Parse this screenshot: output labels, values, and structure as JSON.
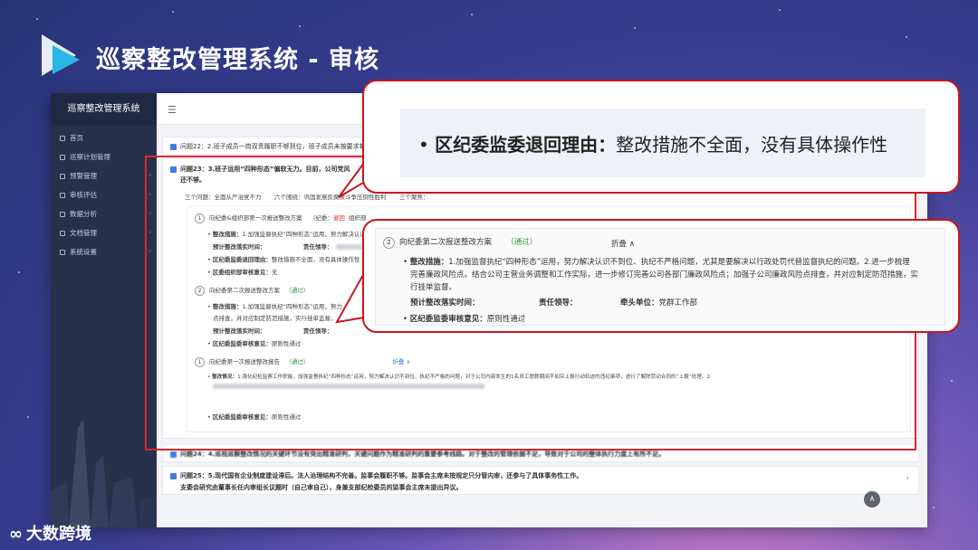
{
  "slide": {
    "title": "巡察整改管理系统 - 审核",
    "watermark": "大数跨境"
  },
  "app": {
    "sidebar_title": "巡察整改管理系统",
    "menu": [
      {
        "label": "首页"
      },
      {
        "label": "巡察计划管理"
      },
      {
        "label": "预警管理"
      },
      {
        "label": "审核评估"
      },
      {
        "label": "数据分析"
      },
      {
        "label": "文档管理"
      },
      {
        "label": "系统设置"
      }
    ]
  },
  "issues": {
    "q22": {
      "title": "问题22：2.班子成员一岗双责履职不够到位，班子成员未按要求每季"
    },
    "q23": {
      "title": "问题23：3.班子运用“四种形态”偏软无力。目前，公司党风",
      "title2": "还不够。",
      "tags": "三个问题：全面从严治党不力",
      "tags2": "六个围绕：巩固发展反腐败斗争压倒性胜利",
      "tags3": "三个聚焦：",
      "step1": {
        "num": "1",
        "title": "向纪委&组织部第一次报送整改方案",
        "record": "（纪委：",
        "status": "退回",
        "record2": "组织部",
        "measure_label": "整改措施：",
        "measure": "1.加强监督执纪“四种形态”运用，努力解决认识",
        "plan_label": "预计整改落实时间：",
        "leader_label": "责任领导：",
        "reject_label": "区纪委监委退回理由：",
        "reject": "整改措施不全面，没有具体操作性",
        "org_label": "区委组织部审核意见：",
        "org": "无"
      },
      "step2": {
        "num": "2",
        "title": "向纪委第二次报送整改方案",
        "status": "（通过）",
        "measure_label": "整改措施：",
        "measure": "1.加强监督执纪“四种形态”运用，努力",
        "measure2": "点排查，并对应制定防范措施，实行挂单监督。",
        "plan_label": "预计整改落实时间：",
        "leader_label": "责任领导：",
        "opinion_label": "区纪委监委审核意见：",
        "opinion": "原则性通过"
      },
      "step3": {
        "num": "1",
        "title": "向纪委第一次报送整改报告",
        "status": "（通过）",
        "fold": "折叠 ∧",
        "measure_label": "整改情况：",
        "measure": "1.强化纪检监察工作职能，加强监督执纪“四种形态”运用，努力解决认识不到位、执纪不严格的问题，对于公司内部发生的1名员工提薪期间不如实上报行动轨迹的违纪事项，进行了解除劳动合同的“上报”处理。2.",
        "opinion_label": "区纪委监委审核意见：",
        "opinion": "原则性通过"
      }
    },
    "q24": {
      "title": "问题24：4.巡视巡察整改情况的关键环节没有突出精准研判，关键问题作为精准研判的重要参考线路。对于整改的管理依据不足，导致对于公司的整体执行力度上有所不足。"
    },
    "q25": {
      "title": "问题25：5.现代国有企业制度建设滞后。法人治理结构不完善。监事会履职不够。监事会主席未按规定只分管内审，还参与了具体事务性工作。",
      "title2": "支委会研究由董事长任内审组长议题时（自己审自己），身兼支部纪检委员的监事会主席未提出异议。"
    }
  },
  "callout1": {
    "label": "区纪委监委退回理由：",
    "text": "整改措施不全面，没有具体操作性"
  },
  "callout2": {
    "num": "2",
    "title": "向纪委第二次报送整改方案",
    "status": "（通过）",
    "fold": "折叠 ∧",
    "measure_label": "整改措施：",
    "measure_l1": "1.加强监督执纪“四种形态”运用，努力解决认识不到位、执纪不严格问题，尤其是要解决以行政处罚代替监督执纪的问题。2.进一步梳理",
    "measure_l2": "完善廉政风险点。结合公司主营业务调整和工作实际，进一步修订完善公司各部门廉政风险点；加强子公司廉政风险点排查，并对应制定防范措施，实",
    "measure_l3": "行挂单监督。",
    "plan_label": "预计整改落实时间：",
    "leader_label": "责任领导：",
    "unit_label": "牵头单位：",
    "unit": "党群工作部",
    "opinion_label": "区纪委监委审核意见：",
    "opinion": "原则性通过"
  },
  "colors": {
    "accent": "#3f7de0",
    "highlight": "#d9272e",
    "pass": "#2c9a3c"
  }
}
